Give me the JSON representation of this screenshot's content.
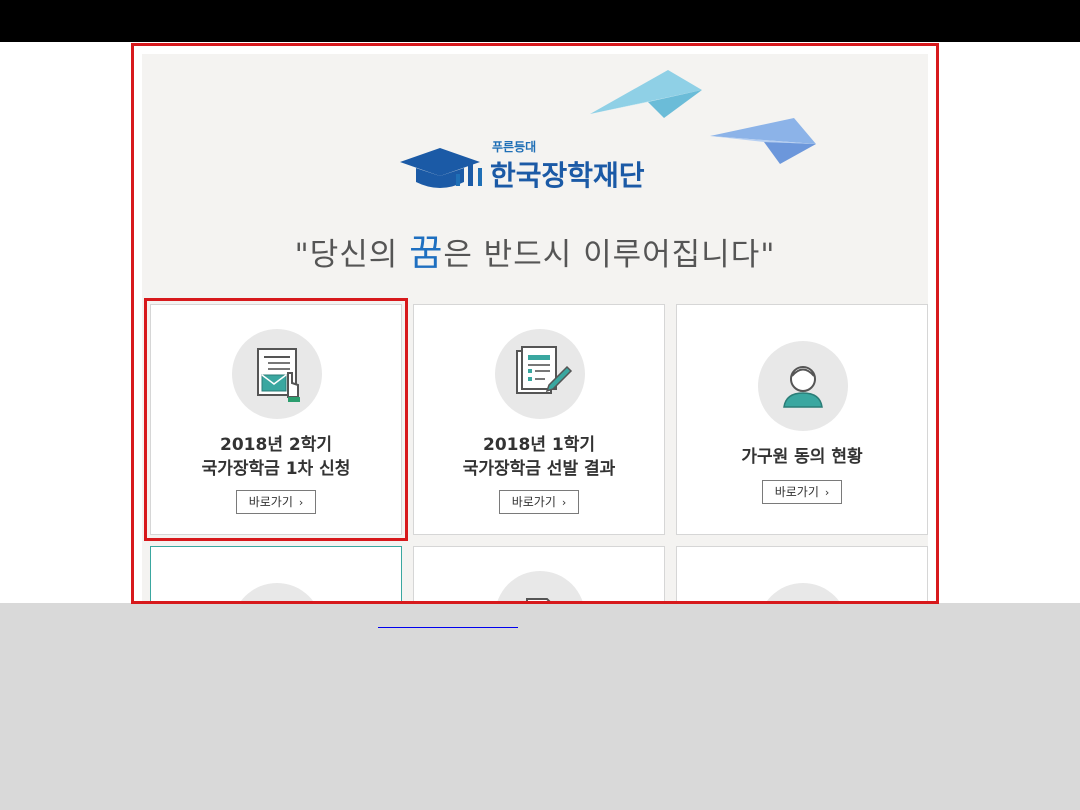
{
  "brand": {
    "sub": "푸른등대",
    "name": "한국장학재단"
  },
  "slogan": {
    "open": "\"당신의 ",
    "dream": "꿈",
    "close": "은 반드시 이루어집니다\""
  },
  "cards": [
    {
      "title_line1": "2018년 2학기",
      "title_line2": "국가장학금 1차 신청",
      "button": "바로가기",
      "icon": "application-form-icon"
    },
    {
      "title_line1": "2018년 1학기",
      "title_line2": "국가장학금 선발 결과",
      "button": "바로가기",
      "icon": "documents-pencil-icon"
    },
    {
      "title_line1": "가구원 동의 현황",
      "button": "바로가기",
      "icon": "person-icon"
    }
  ],
  "colors": {
    "brand_blue": "#1b5aa6",
    "highlight_red": "#d7191c",
    "teal": "#3aa7a0"
  }
}
